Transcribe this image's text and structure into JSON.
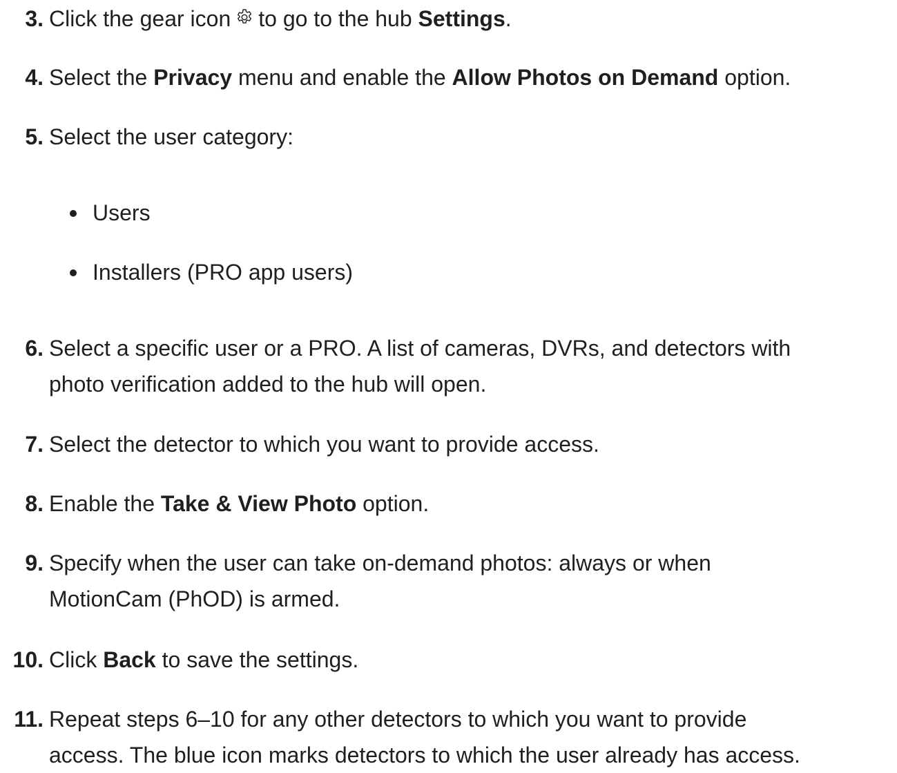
{
  "steps": {
    "s3": {
      "number": "3.",
      "pre": "Click the gear icon",
      "mid": "to go to the hub",
      "bold": "Settings",
      "post": "."
    },
    "s4": {
      "number": "4.",
      "pre": "Select the",
      "bold1": "Privacy",
      "mid": "menu and enable the",
      "bold2": "Allow Photos on Demand",
      "post": "option."
    },
    "s5": {
      "number": "5.",
      "text": "Select the user category:"
    },
    "s6": {
      "number": "6.",
      "line1": "Select a specific user or a PRO. A list of cameras, DVRs, and detectors with",
      "line2": "photo verification added to the hub will open."
    },
    "s7": {
      "number": "7.",
      "text": "Select the detector to which you want to provide access."
    },
    "s8": {
      "number": "8.",
      "pre": "Enable the",
      "bold": "Take & View Photo",
      "post": "option."
    },
    "s9": {
      "number": "9.",
      "line1": "Specify when the user can take on-demand photos: always or when",
      "line2": "MotionCam (PhOD) is armed."
    },
    "s10": {
      "number": "10.",
      "pre": "Click",
      "bold": "Back",
      "post": "to save the settings."
    },
    "s11": {
      "number": "11.",
      "line1": "Repeat steps 6–10 for any other detectors to which you want to provide",
      "line2": "access. The blue icon marks detectors to which the user already has access."
    }
  },
  "categories": [
    "Users",
    "Installers (PRO app users)"
  ],
  "icons": {
    "gear": "gear-icon"
  },
  "colors": {
    "text": "#1f1f1f",
    "background": "#ffffff"
  }
}
